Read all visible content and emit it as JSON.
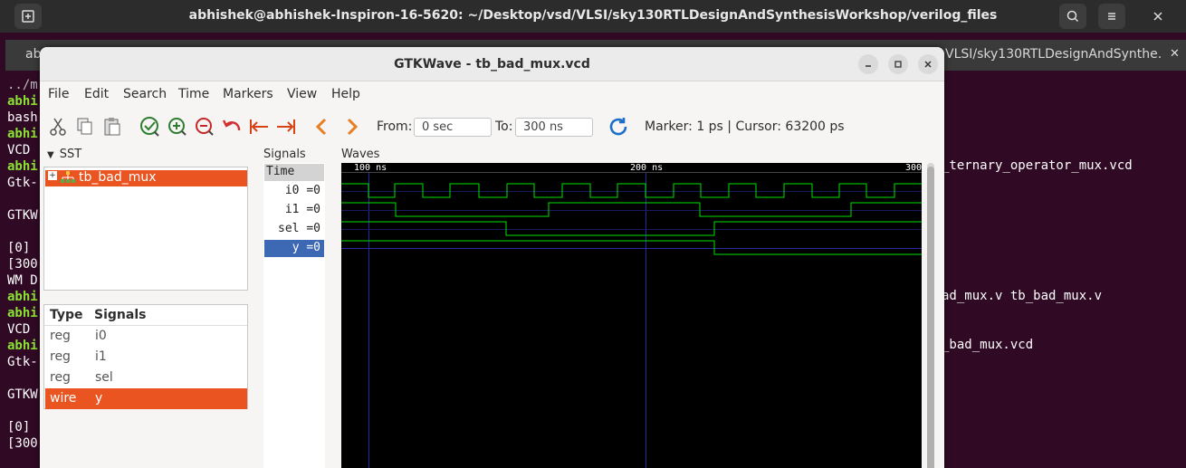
{
  "terminal": {
    "title": "abhishek@abhishek-Inspiron-16-5620: ~/Desktop/vsd/VLSI/sky130RTLDesignAndSynthesisWorkshop/verilog_files",
    "tab_left": "ab",
    "tab_right": "VLSI/sky130RTLDesignAndSynthe...",
    "left_lines": [
      "../m",
      "abhi",
      "bash",
      "abhi",
      "VCD",
      "abhi",
      "Gtk-",
      "GTKW",
      "[0]",
      "[300",
      "WM D",
      "abhi",
      "abhi",
      "VCD",
      "abhi",
      "Gtk-",
      "GTKW",
      "[0]",
      "[300"
    ],
    "right_lines": [
      "_ternary_operator_mux.vcd",
      "ad_mux.v tb_bad_mux.v",
      "_bad_mux.vcd"
    ]
  },
  "window": {
    "title": "GTKWave - tb_bad_mux.vcd"
  },
  "menu": [
    "File",
    "Edit",
    "Search",
    "Time",
    "Markers",
    "View",
    "Help"
  ],
  "toolbar": {
    "from_label": "From:",
    "from_value": "0 sec",
    "to_label": "To:",
    "to_value": "300 ns",
    "marker_text": "Marker: 1 ps  |  Cursor: 63200 ps"
  },
  "sst": {
    "label": "SST",
    "tree_item": "tb_bad_mux"
  },
  "signal_list": {
    "headers": {
      "type": "Type",
      "signals": "Signals"
    },
    "rows": [
      {
        "type": "reg",
        "name": "i0"
      },
      {
        "type": "reg",
        "name": "i1"
      },
      {
        "type": "reg",
        "name": "sel"
      },
      {
        "type": "wire",
        "name": "y"
      }
    ]
  },
  "signals_pane": {
    "label": "Signals",
    "header": "Time",
    "items": [
      "i0 =0",
      "i1 =0",
      "sel =0",
      "y =0"
    ]
  },
  "waves_pane": {
    "label": "Waves",
    "time_labels": [
      "100 ns",
      "200 ns",
      "300"
    ],
    "colors": {
      "trace": "#00e000",
      "grid": "#2a2aa0",
      "bg": "#000000"
    }
  }
}
